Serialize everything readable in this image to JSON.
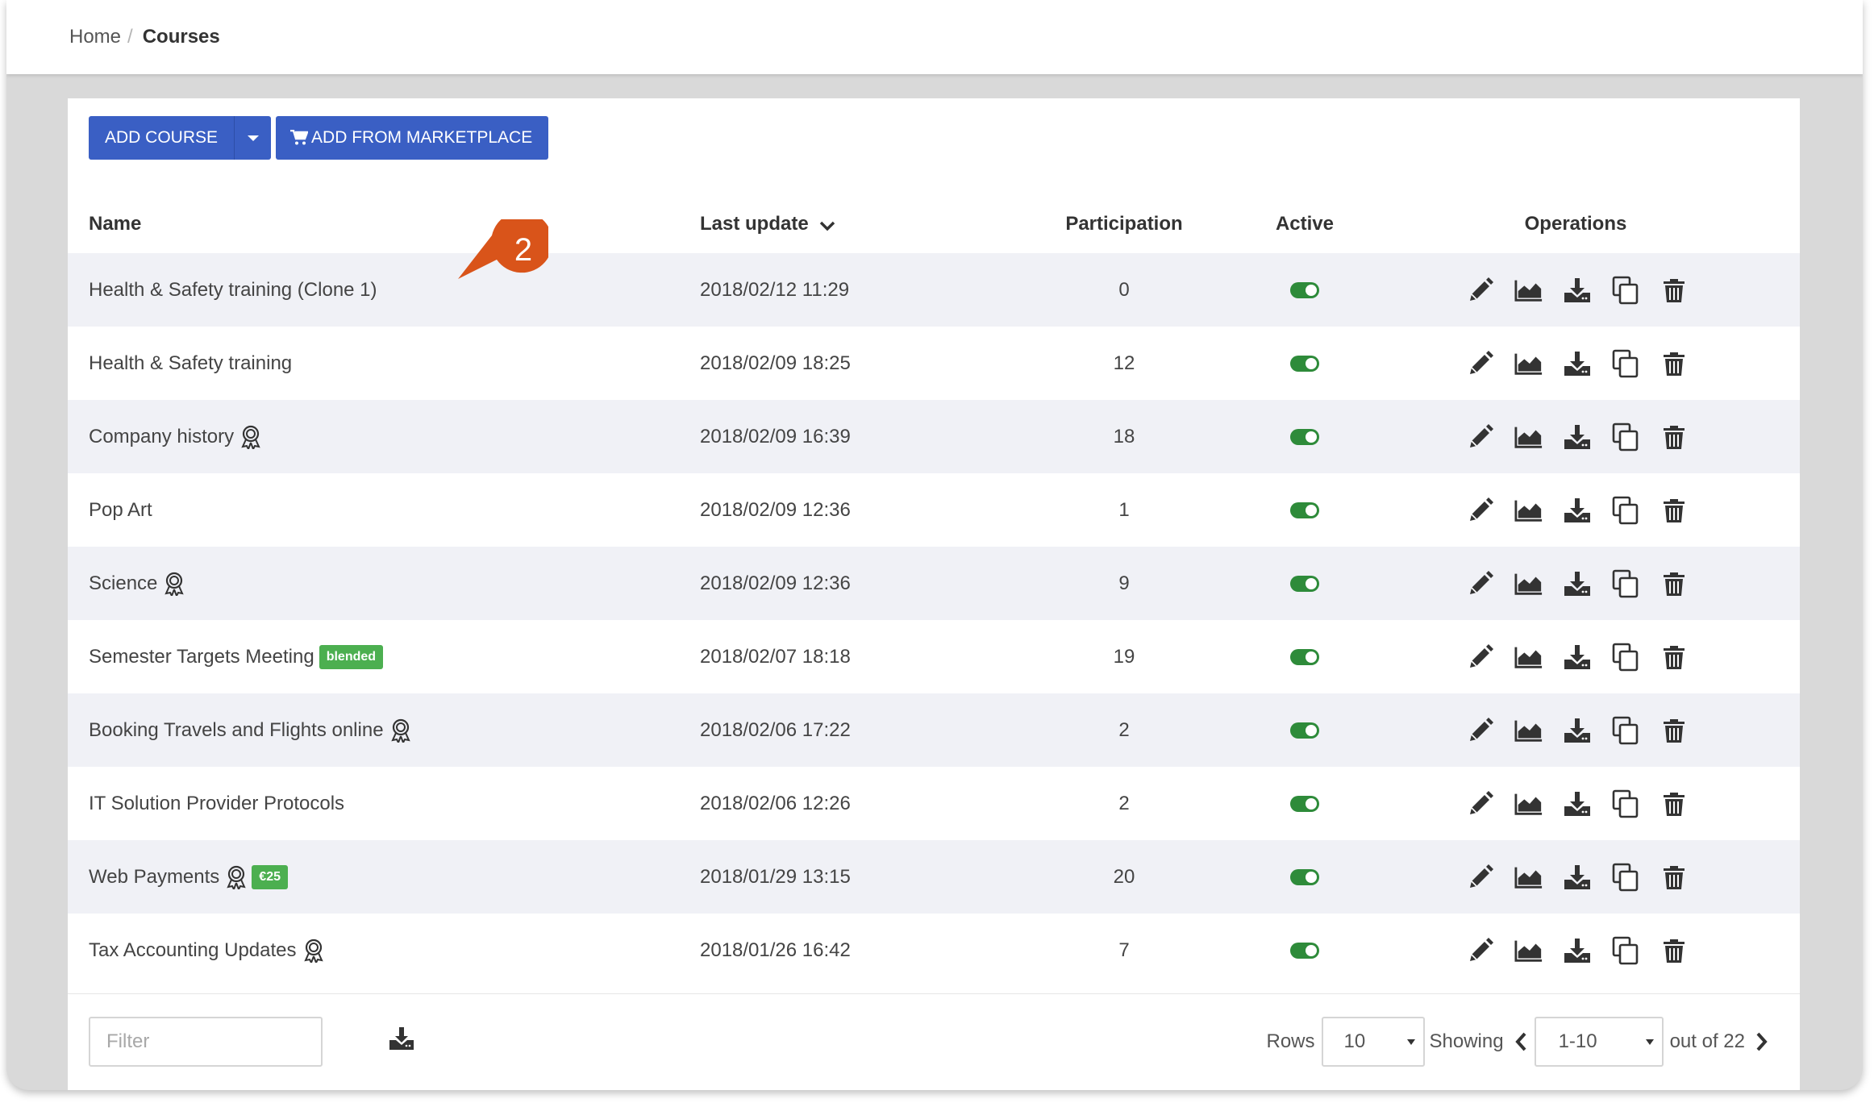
{
  "breadcrumb": {
    "home": "Home",
    "separator": "/",
    "current": "Courses"
  },
  "toolbar": {
    "add_course": "ADD COURSE",
    "add_marketplace": "ADD FROM MARKETPLACE"
  },
  "table": {
    "columns": {
      "name": "Name",
      "last_update": "Last update",
      "participation": "Participation",
      "active": "Active",
      "operations": "Operations"
    },
    "rows": [
      {
        "name": "Health & Safety training (Clone 1)",
        "date": "2018/02/12 11:29",
        "participation": "0",
        "award": false,
        "badge": "",
        "active": true
      },
      {
        "name": "Health & Safety training",
        "date": "2018/02/09 18:25",
        "participation": "12",
        "award": false,
        "badge": "",
        "active": true
      },
      {
        "name": "Company history",
        "date": "2018/02/09 16:39",
        "participation": "18",
        "award": true,
        "badge": "",
        "active": true
      },
      {
        "name": "Pop Art",
        "date": "2018/02/09 12:36",
        "participation": "1",
        "award": false,
        "badge": "",
        "active": true
      },
      {
        "name": "Science",
        "date": "2018/02/09 12:36",
        "participation": "9",
        "award": true,
        "badge": "",
        "active": true
      },
      {
        "name": "Semester Targets Meeting",
        "date": "2018/02/07 18:18",
        "participation": "19",
        "award": false,
        "badge": "blended",
        "active": true
      },
      {
        "name": "Booking Travels and Flights online",
        "date": "2018/02/06 17:22",
        "participation": "2",
        "award": true,
        "badge": "",
        "active": true
      },
      {
        "name": "IT Solution Provider Protocols",
        "date": "2018/02/06 12:26",
        "participation": "2",
        "award": false,
        "badge": "",
        "active": true
      },
      {
        "name": "Web Payments",
        "date": "2018/01/29 13:15",
        "participation": "20",
        "award": true,
        "badge": "€25",
        "active": true
      },
      {
        "name": "Tax Accounting Updates",
        "date": "2018/01/26 16:42",
        "participation": "7",
        "award": true,
        "badge": "",
        "active": true
      }
    ],
    "operation_icons": [
      "pencil-icon",
      "chart-icon",
      "download-icon",
      "copy-icon",
      "trash-icon"
    ]
  },
  "marker": {
    "number": "2",
    "color": "#d9541a"
  },
  "footer": {
    "filter_placeholder": "Filter",
    "rows_label": "Rows",
    "rows_value": "10",
    "showing_label": "Showing",
    "page_range": "1-10",
    "total_label": "out of 22"
  },
  "colors": {
    "primary": "#3a5fc4",
    "toggle_on": "#2e8b3a",
    "badge": "#4caf50",
    "stripe": "#f0f1f6"
  }
}
